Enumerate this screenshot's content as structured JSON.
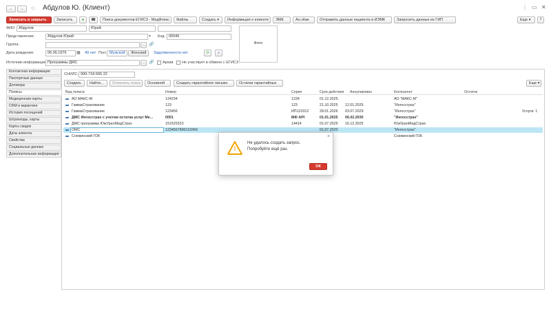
{
  "window": {
    "title": "Абдулов Ю. (Клиент)",
    "menu_glyph": "⋮",
    "maximize_glyph": "▭",
    "close_glyph": "✕"
  },
  "nav": {
    "back": "←",
    "forward": "→",
    "star": "☆"
  },
  "toolbar": {
    "save_close": "Записать и закрыть",
    "save": "Записать",
    "search_egisz": "Поиск документов ЕГИСЗ - МедФлекс",
    "files": "Файлы",
    "create": "Создать ▾",
    "client_info": "Информация о клиенте ▾",
    "emk": "ЭМК",
    "anvitae": "Ан.vitae",
    "send_iemk": "Отправить данные пациента в ИЭМК",
    "request_gip": "Запросить данные из ГИП",
    "more": "Еще ▾",
    "help": "?"
  },
  "form": {
    "fio_label": "ФИО",
    "last_name": "Абдулов",
    "first_name": "Юрий",
    "middle_name": "",
    "representation_label": "Представление:",
    "representation": "Абдулов Юрий",
    "code_label": "Код:",
    "code": "00046",
    "group_label": "Группа:",
    "group": "",
    "dob_label": "Дата рождения:",
    "dob": "06.06.1976",
    "age": "49 лет",
    "sex_label": "Пол:",
    "sex_male": "Мужской",
    "sex_female": "Женский",
    "debt": "Задолженности нет",
    "source_label": "Источник информации:",
    "source": "Программы ДМС",
    "archive": "Архив",
    "no_egisz": "Не участвует в обмене с ЕГИСЗ",
    "photo": "Фото"
  },
  "sidebar": {
    "items": [
      {
        "label": "Контактная информация"
      },
      {
        "label": "Паспортные данные"
      },
      {
        "label": "Договоры"
      },
      {
        "label": "Полисы"
      },
      {
        "label": "Медицинские карты"
      },
      {
        "label": "CRM и маркетинг"
      },
      {
        "label": "История посещений"
      },
      {
        "label": "Штрихкоды, карты"
      },
      {
        "label": "Карты скидок"
      },
      {
        "label": "Даты клиента"
      },
      {
        "label": "Свойства"
      },
      {
        "label": "Социальные данные"
      },
      {
        "label": "Дополнительная информация"
      }
    ]
  },
  "policies": {
    "snils_label": "СНИЛС:",
    "snils": "990-718-565 22",
    "btn_create": "Создать",
    "btn_find": "Найти...",
    "btn_cancel_search": "Отменить поиск",
    "btn_main": "Основной",
    "btn_create_letter": "Создать гарантийное письмо",
    "btn_remains": "Остатки гарантийных",
    "btn_more": "Еще ▾",
    "columns": [
      "Вид полиса",
      "Номер",
      "Серия",
      "Срок действия",
      "Аннулирован",
      "Контрагент",
      "Остаток"
    ],
    "rows": [
      {
        "type": "АО МАКС-М",
        "number": "124234",
        "series": "1234",
        "from": "01.12.2025",
        "to": "",
        "annulled": "",
        "contractor": "АО \"МАКС-М\"",
        "remain": ""
      },
      {
        "type": "ГаммаСтрахование",
        "number": "123",
        "series": "123",
        "from": "21.10.2025",
        "to": "12.01.2025",
        "annulled": "",
        "contractor": "\"Ингосстрах\"",
        "remain": ""
      },
      {
        "type": "ГаммаСтрахование",
        "number": "123456",
        "series": "ИП123312",
        "from": "28.01.2026",
        "to": "03.07.2029",
        "annulled": "",
        "contractor": "\"Ингосстрах\"",
        "remain": "Услуги: 1"
      },
      {
        "type": "ДМС Ингосстрах с учетом остатка услуг Ме...",
        "number": "0001",
        "series": "МФ АРІ",
        "from": "01.01.2025",
        "to": "06.02.2030",
        "annulled": "",
        "contractor": "\"Ингосстрах\"",
        "remain": ""
      },
      {
        "type": "ДМС программа ЮжУралМедСтрах",
        "number": "151525323",
        "series": "14414",
        "from": "01.07.2025",
        "to": "16.12.2025",
        "annulled": "",
        "contractor": "ЮжУралМедСтрах",
        "remain": ""
      },
      {
        "type": "ОМС",
        "number": "1234567890123456",
        "series": "",
        "from": "01.07.2020",
        "to": "",
        "annulled": "",
        "contractor": "\"Ингосстрах\"",
        "remain": ""
      },
      {
        "type": "Снежинский ГОК",
        "number": "",
        "series": "",
        "from": "",
        "to": "",
        "annulled": "",
        "contractor": "Снежинский ГОК",
        "remain": ""
      }
    ]
  },
  "dialog": {
    "message_line1": "Не удалось создать запрос.",
    "message_line2": "Попробуйте ещё раз.",
    "ok": "ОК",
    "close": "×",
    "warning_glyph": "!"
  },
  "colors": {
    "accent_red": "#d63a2f",
    "selection": "#bde6f5",
    "link": "#1f5fbf",
    "warning": "#f0a500"
  }
}
